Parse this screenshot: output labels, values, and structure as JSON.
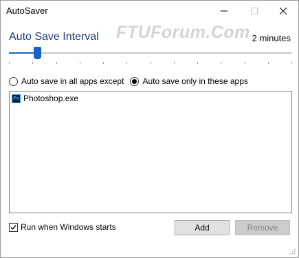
{
  "window": {
    "title": "AutoSaver"
  },
  "watermark": "FTUForum.Com",
  "interval": {
    "label": "Auto Save Interval",
    "value": "2 minutes",
    "slider_fraction": 0.1
  },
  "mode": {
    "options": [
      {
        "label": "Auto save in all apps except",
        "selected": false
      },
      {
        "label": "Auto save only in these apps",
        "selected": true
      }
    ]
  },
  "apps": {
    "items": [
      {
        "label": "Photoshop.exe",
        "icon": "photoshop-icon",
        "icon_text": "Ps"
      }
    ]
  },
  "startup": {
    "label": "Run when Windows starts",
    "checked": true
  },
  "buttons": {
    "add": "Add",
    "remove": "Remove"
  },
  "colors": {
    "accent": "#1565c0",
    "heading": "#1f3a78"
  }
}
